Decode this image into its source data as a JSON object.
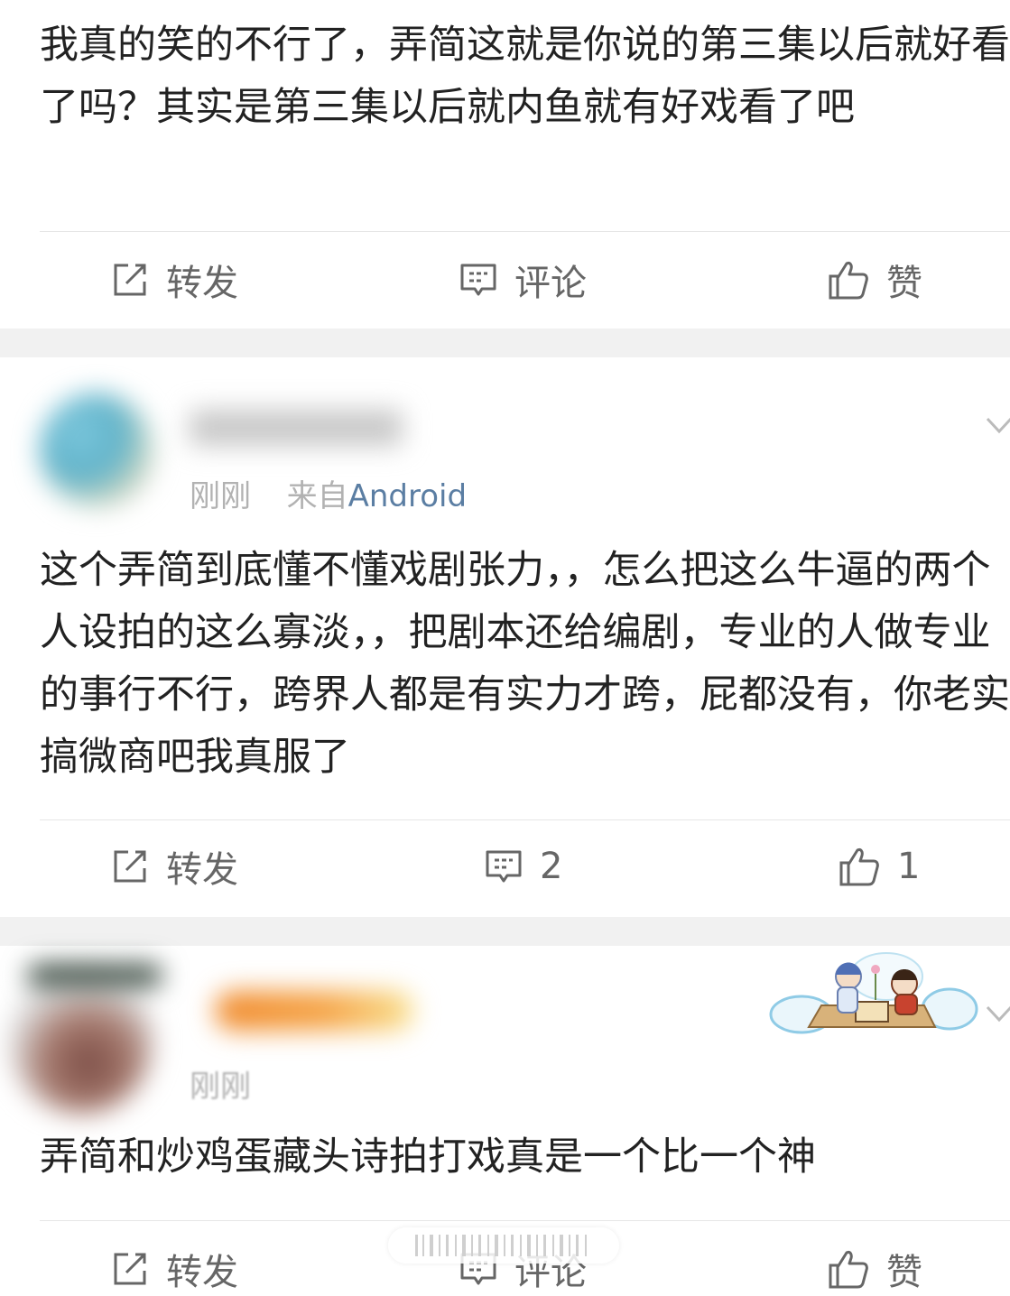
{
  "post1": {
    "text": "我真的笑的不行了，弄简这就是你说的第三集以后就好看了吗？其实是第三集以后就内鱼就有好戏看了吧",
    "actions": {
      "repost_label": "转发",
      "comment_label": "评论",
      "like_label": "赞"
    }
  },
  "post2": {
    "username": "",
    "time": "刚刚",
    "source_prefix": "来自",
    "source": "Android",
    "text": "这个弄简到底懂不懂戏剧张力，，怎么把这么牛逼的两个人设拍的这么寡淡，，把剧本还给编剧，专业的人做专业的事行不行，跨界人都是有实力才跨，屁都没有，你老实搞微商吧我真服了",
    "actions": {
      "repost_label": "转发",
      "comment_count": "2",
      "like_count": "1"
    }
  },
  "post3": {
    "username": "",
    "time": "刚刚",
    "text": "弄简和炒鸡蛋藏头诗拍打戏真是一个比一个神",
    "actions": {
      "repost_label": "转发",
      "comment_label": "评论",
      "like_label": "赞"
    }
  },
  "colors": {
    "text": "#222222",
    "secondary": "#666666",
    "meta": "#b2b2b2",
    "link": "#5b7ea3",
    "separator": "#f1f1f1"
  }
}
